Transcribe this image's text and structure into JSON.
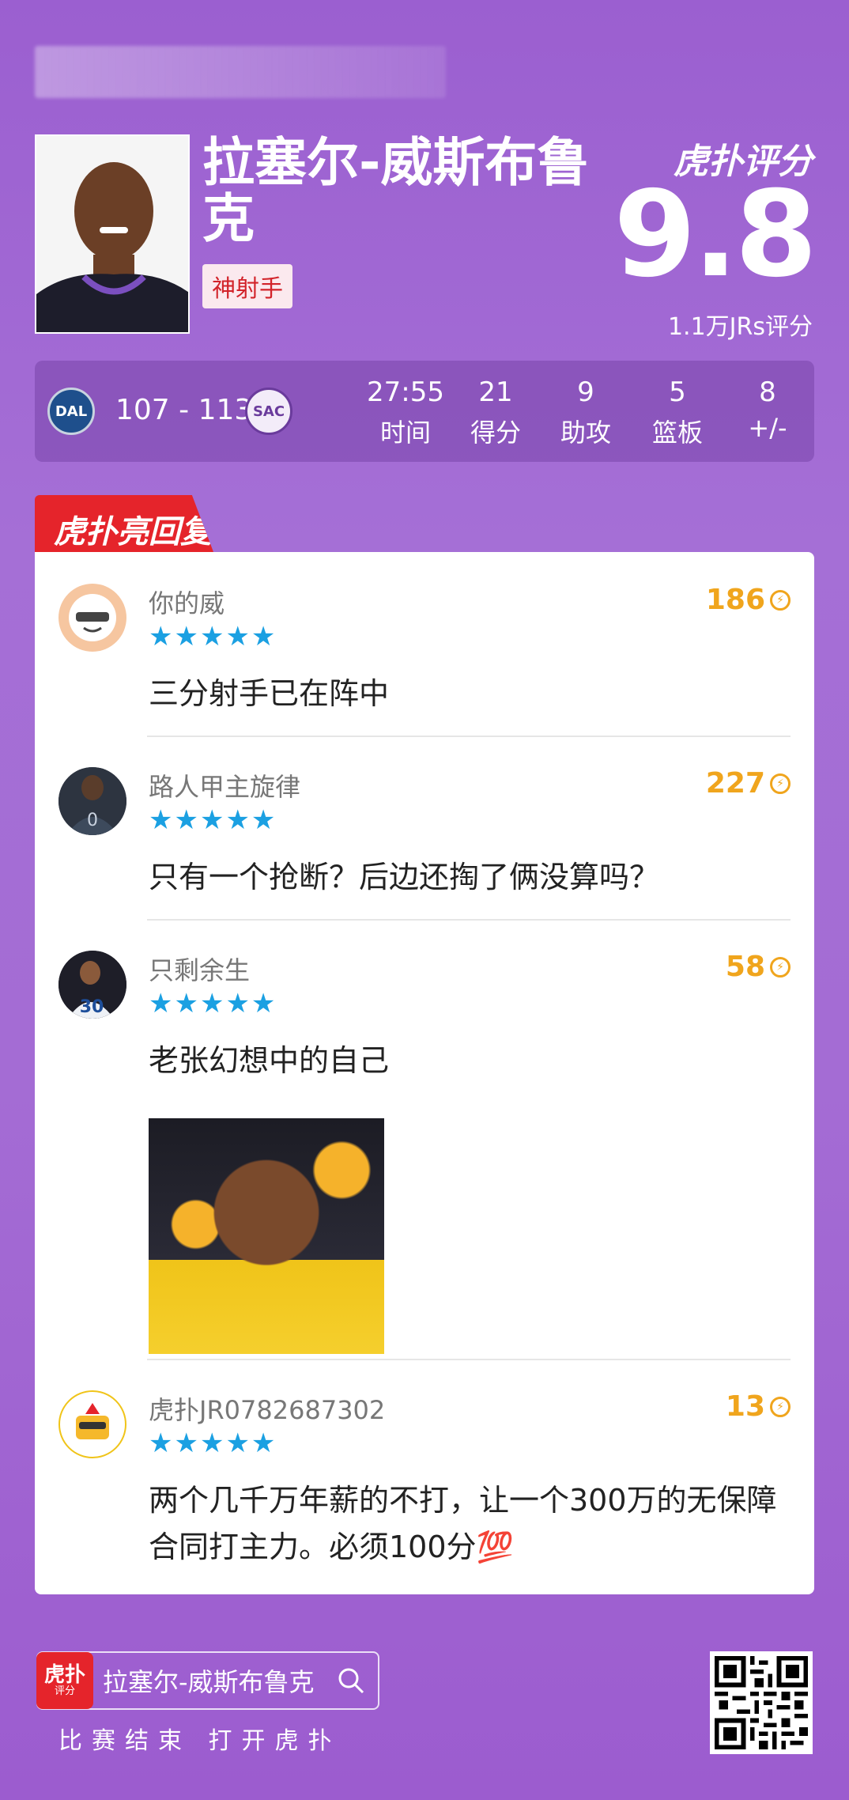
{
  "player": {
    "name": "拉塞尔-威斯布鲁克",
    "tag": "神射手"
  },
  "rating": {
    "brand": "虎扑评分",
    "score": "9.8",
    "count": "1.1万JRs评分"
  },
  "game": {
    "team_home": "DAL",
    "team_away": "SAC",
    "score": "107 - 113",
    "stats": [
      {
        "value": "27:55",
        "label": "时间"
      },
      {
        "value": "21",
        "label": "得分"
      },
      {
        "value": "9",
        "label": "助攻"
      },
      {
        "value": "5",
        "label": "篮板"
      },
      {
        "value": "8",
        "label": "+/-"
      }
    ]
  },
  "section_title": "虎扑亮回复",
  "comments": [
    {
      "user": "你的威",
      "stars": "★★★★★",
      "likes": "186",
      "text": "三分射手已在阵中",
      "avatar_icon": "cool-emoji-icon"
    },
    {
      "user": "路人甲主旋律",
      "stars": "★★★★★",
      "likes": "227",
      "text": "只有一个抢断？后边还掏了俩没算吗？",
      "avatar_icon": "player-back-avatar"
    },
    {
      "user": "只剩余生",
      "stars": "★★★★★",
      "likes": "58",
      "text": "老张幻想中的自己",
      "avatar_icon": "player-30-avatar"
    },
    {
      "user": "虎扑JR0782687302",
      "stars": "★★★★★",
      "likes": "13",
      "text": "两个几千万年薪的不打，让一个300万的无保障合同打主力。必须100分💯",
      "avatar_icon": "sunglasses-emoji-icon"
    }
  ],
  "footer": {
    "app_name": "虎扑",
    "app_sub": "评分",
    "search_text": "拉塞尔-威斯布鲁克",
    "note": "比赛结束 打开虎扑"
  },
  "colors": {
    "background": "#9b5fd0",
    "accent_red": "#e5242b",
    "star_blue": "#1ba0e2",
    "likes_orange": "#f0a51d"
  }
}
